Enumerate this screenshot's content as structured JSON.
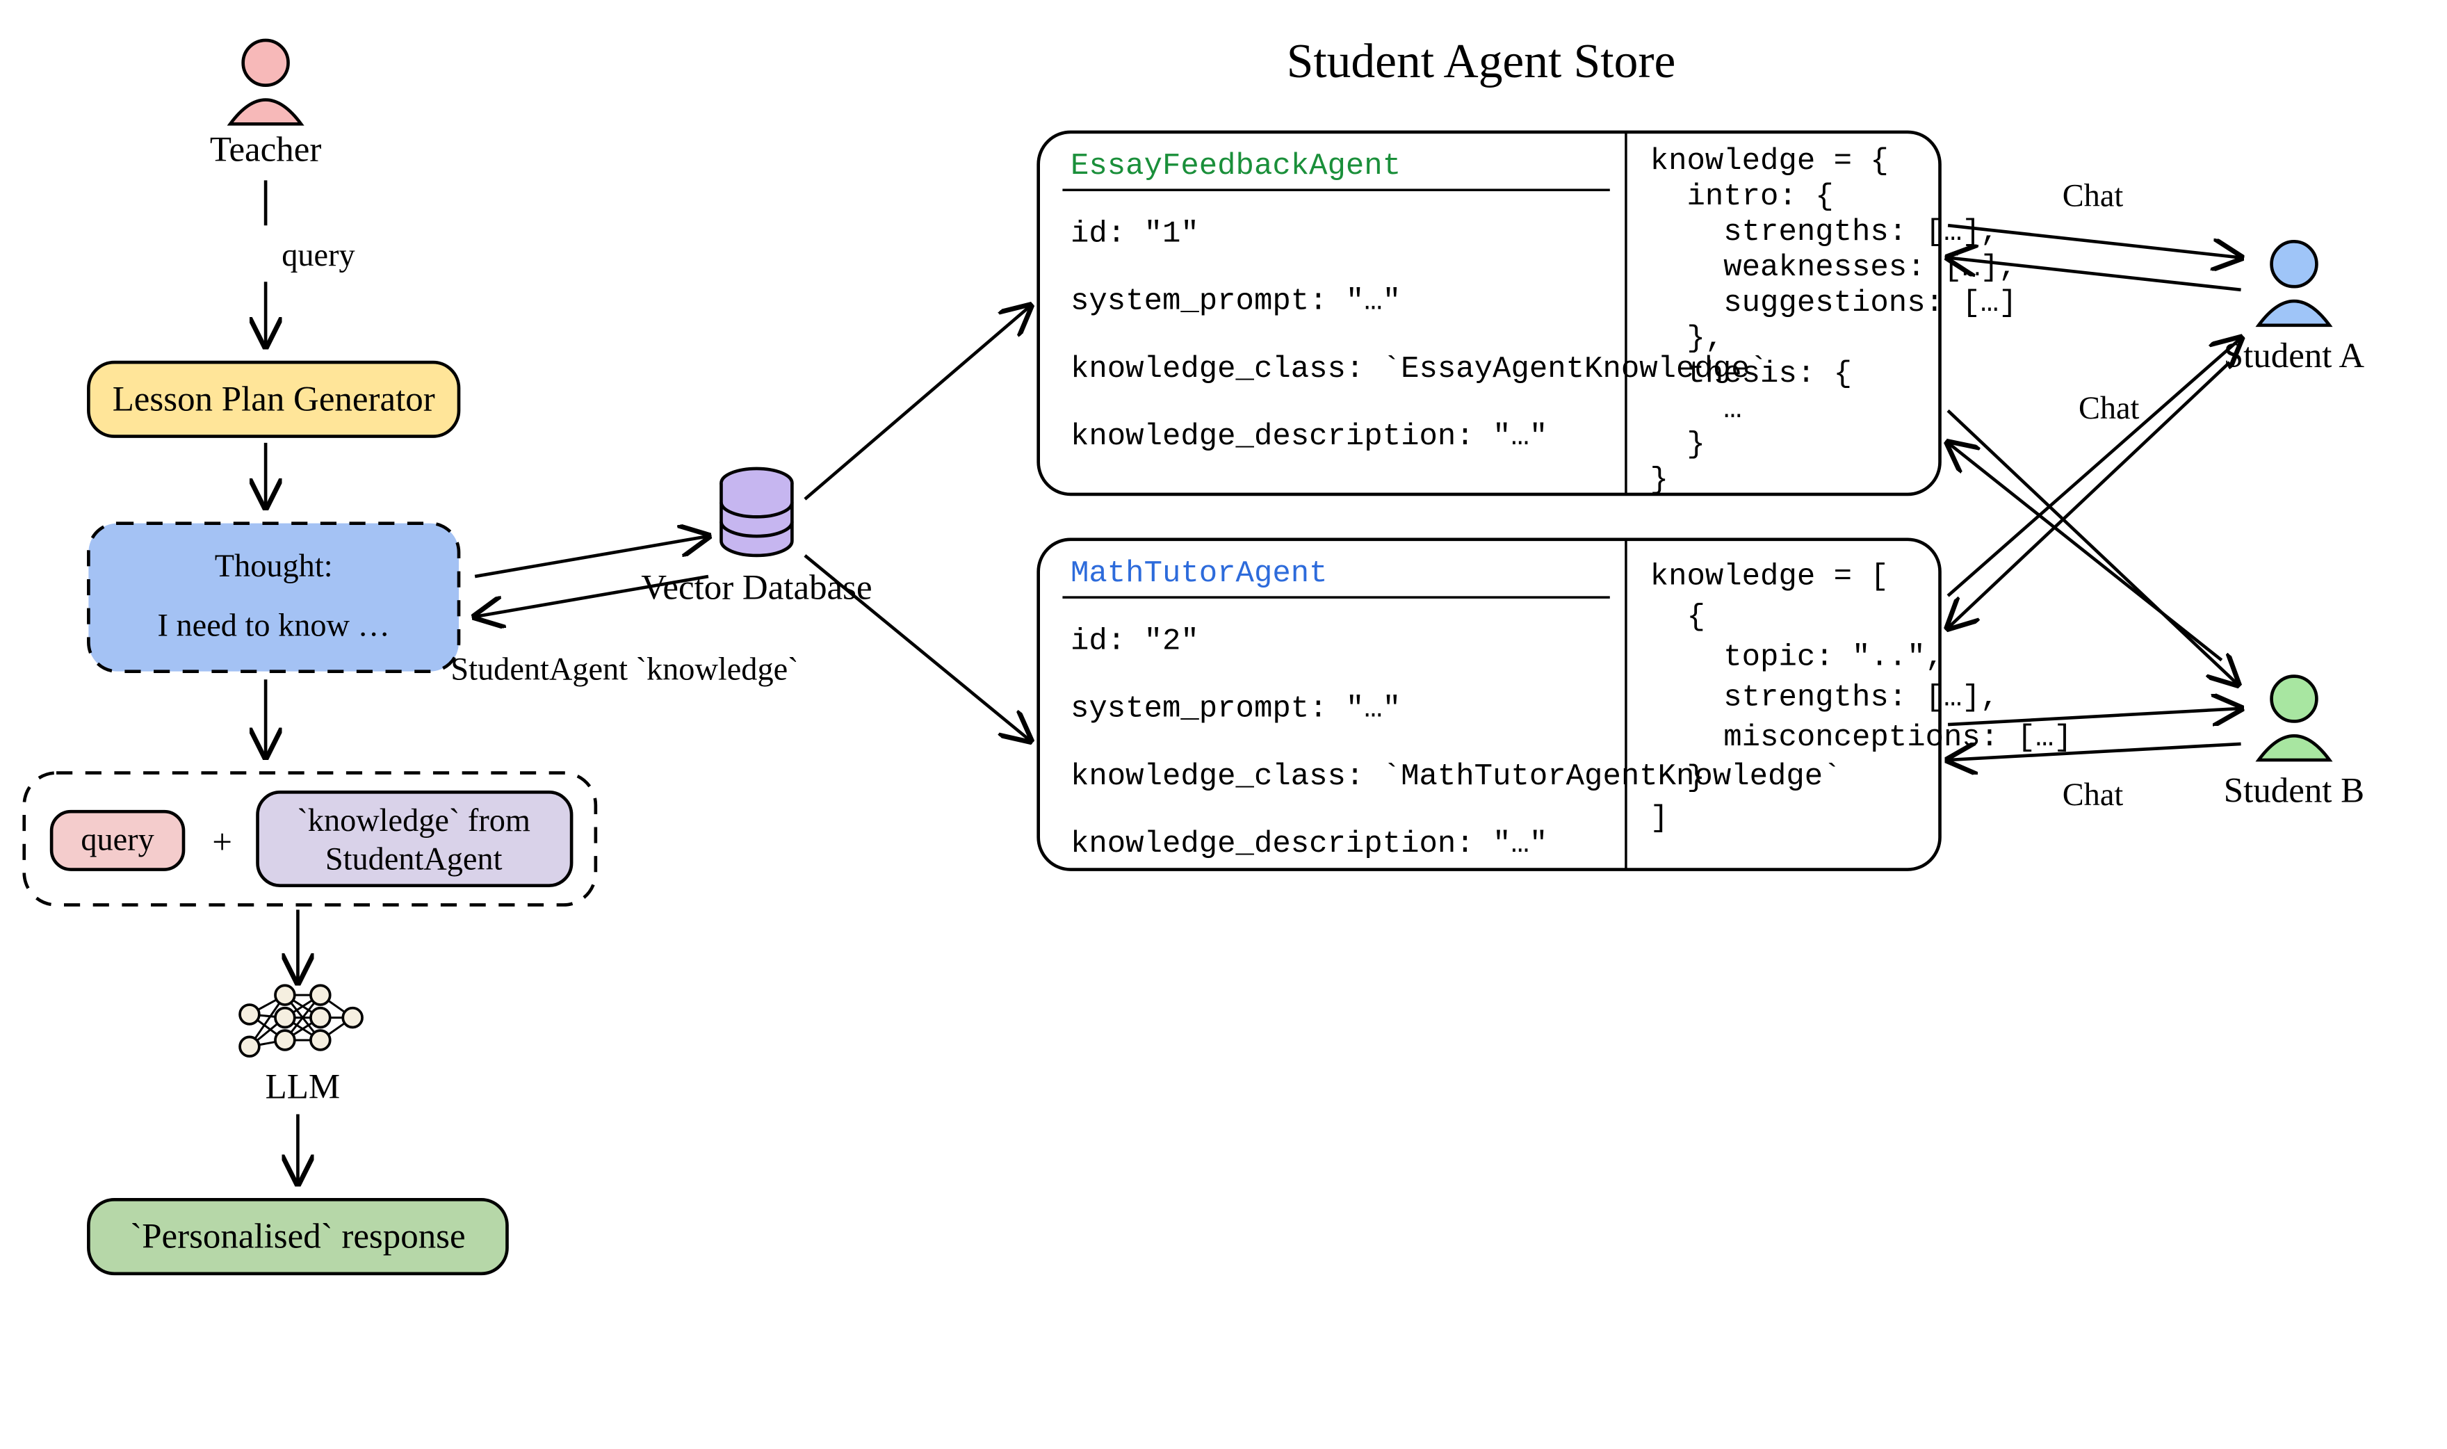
{
  "title": "Student Agent Store",
  "left": {
    "teacher_label": "Teacher",
    "query_edge": "query",
    "lesson_plan_label": "Lesson Plan Generator",
    "thought_title": "Thought:",
    "thought_body": "I need to know …",
    "studentagent_knowledge_edge": "StudentAgent `knowledge`",
    "query_pill": "query",
    "plus": "+",
    "knowledge_pill_line1": "`knowledge` from",
    "knowledge_pill_line2": "StudentAgent",
    "llm_label": "LLM",
    "response_label": "`Personalised` response"
  },
  "center": {
    "vector_db_label": "Vector Database"
  },
  "store": {
    "essay": {
      "name": "EssayFeedbackAgent",
      "id_line": "id: \"1\"",
      "system_prompt_line": "system_prompt: \"…\"",
      "knowledge_class_line": "knowledge_class: `EssayAgentKnowledge`",
      "knowledge_description_line": "knowledge_description: \"…\"",
      "knowledge_lines": [
        "knowledge = {",
        "  intro: {",
        "    strengths: […],",
        "    weaknesses: […],",
        "    suggestions: […]",
        "  },",
        "  thesis: {",
        "    …",
        "  }",
        "}"
      ]
    },
    "math": {
      "name": "MathTutorAgent",
      "id_line": "id: \"2\"",
      "system_prompt_line": "system_prompt: \"…\"",
      "knowledge_class_line": "knowledge_class: `MathTutorAgentKnowledge`",
      "knowledge_description_line": "knowledge_description: \"…\"",
      "knowledge_lines": [
        "knowledge = [",
        "  {",
        "    topic: \"..\",",
        "    strengths: […],",
        "    misconceptions: […]",
        "  }",
        "]"
      ]
    }
  },
  "students": {
    "a": "Student A",
    "b": "Student B",
    "chat": "Chat"
  },
  "colors": {
    "yellow": "#ffe599",
    "blue": "#a4c2f4",
    "pink": "#f4cccc",
    "purple": "#d9d2e9",
    "green_box": "#b6d7a8",
    "teacher_fill": "#f7b9b9",
    "studentA_fill": "#9fc5f8",
    "studentB_fill": "#a8e6a1",
    "db_fill": "#c6b6f0",
    "essay_name": "#1a8f3a",
    "math_name": "#2d6bdb"
  }
}
